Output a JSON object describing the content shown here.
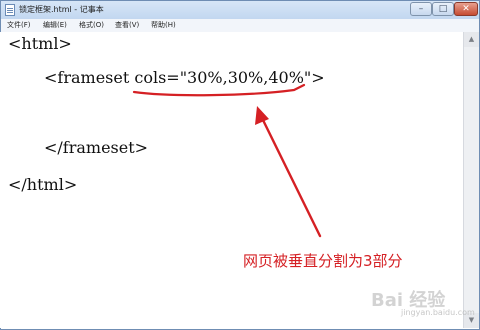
{
  "window": {
    "title": "锁定框架.html - 记事本",
    "min_glyph": "–",
    "max_glyph": "□",
    "close_glyph": "✕"
  },
  "menu": {
    "file": "文件(F)",
    "edit": "编辑(E)",
    "format": "格式(O)",
    "view": "查看(V)",
    "help": "帮助(H)"
  },
  "code": {
    "line1": "<html>",
    "line2_prefix": "<frameset ",
    "line2_attr": "cols=\"30%,30%,40%\"",
    "line2_suffix": ">",
    "line3": "</frameset>",
    "line4": "</html>"
  },
  "annotation": {
    "text": "网页被垂直分割为3部分",
    "color": "#d52024"
  },
  "watermark": {
    "text": "Bai 经验",
    "sub": "jingyan.baidu.com"
  }
}
